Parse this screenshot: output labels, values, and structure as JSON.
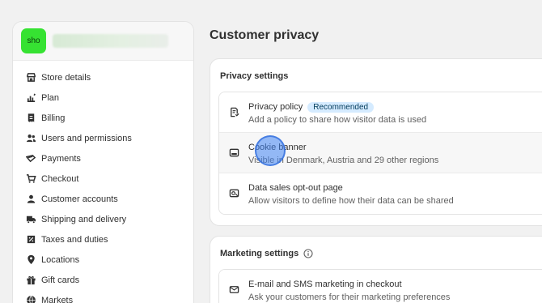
{
  "store": {
    "avatar_text": "sho"
  },
  "sidebar": {
    "items": [
      {
        "label": "Store details",
        "icon": "store-icon"
      },
      {
        "label": "Plan",
        "icon": "chart-icon"
      },
      {
        "label": "Billing",
        "icon": "receipt-icon"
      },
      {
        "label": "Users and permissions",
        "icon": "users-icon"
      },
      {
        "label": "Payments",
        "icon": "payments-icon"
      },
      {
        "label": "Checkout",
        "icon": "cart-icon"
      },
      {
        "label": "Customer accounts",
        "icon": "person-icon"
      },
      {
        "label": "Shipping and delivery",
        "icon": "truck-icon"
      },
      {
        "label": "Taxes and duties",
        "icon": "tax-icon"
      },
      {
        "label": "Locations",
        "icon": "location-icon"
      },
      {
        "label": "Gift cards",
        "icon": "gift-icon"
      },
      {
        "label": "Markets",
        "icon": "globe-icon"
      }
    ]
  },
  "main": {
    "title": "Customer privacy",
    "privacy": {
      "title": "Privacy settings",
      "rows": [
        {
          "title": "Privacy policy",
          "badge": "Recommended",
          "desc": "Add a policy to share how visitor data is used",
          "icon": "policy-icon"
        },
        {
          "title": "Cookie banner",
          "desc": "Visible in Denmark, Austria and 29 other regions",
          "icon": "banner-icon"
        },
        {
          "title": "Data sales opt-out page",
          "desc": "Allow visitors to define how their data can be shared",
          "icon": "optout-icon"
        }
      ]
    },
    "marketing": {
      "title": "Marketing settings",
      "info_icon": "info-icon",
      "rows": [
        {
          "title": "E-mail and SMS marketing in checkout",
          "desc": "Ask your customers for their marketing preferences",
          "icon": "email-icon"
        }
      ]
    }
  },
  "colors": {
    "avatar_bg": "#36e232",
    "badge_bg": "#d5ebff",
    "cursor": "#4285f4"
  }
}
